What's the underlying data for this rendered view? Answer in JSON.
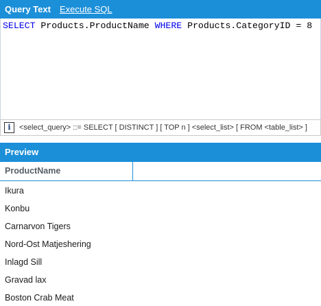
{
  "tabs": {
    "query_text": "Query Text",
    "execute_sql": "Execute SQL"
  },
  "editor": {
    "kw_select": "SELECT",
    "part1": " Products.ProductName ",
    "kw_where": "WHERE",
    "part2": " Products.CategoryID = 8"
  },
  "hint": {
    "icon": "info-icon",
    "text": "<select_query> ::= SELECT [ DISTINCT ] [ TOP n ] <select_list> [ FROM <table_list> ]"
  },
  "preview": {
    "title": "Preview",
    "column": "ProductName",
    "rows": [
      "Ikura",
      "Konbu",
      "Carnarvon Tigers",
      "Nord-Ost Matjeshering",
      "Inlagd Sill",
      "Gravad lax",
      "Boston Crab Meat"
    ]
  },
  "colors": {
    "accent": "#1c8fd9",
    "keyword": "#0000ee"
  }
}
